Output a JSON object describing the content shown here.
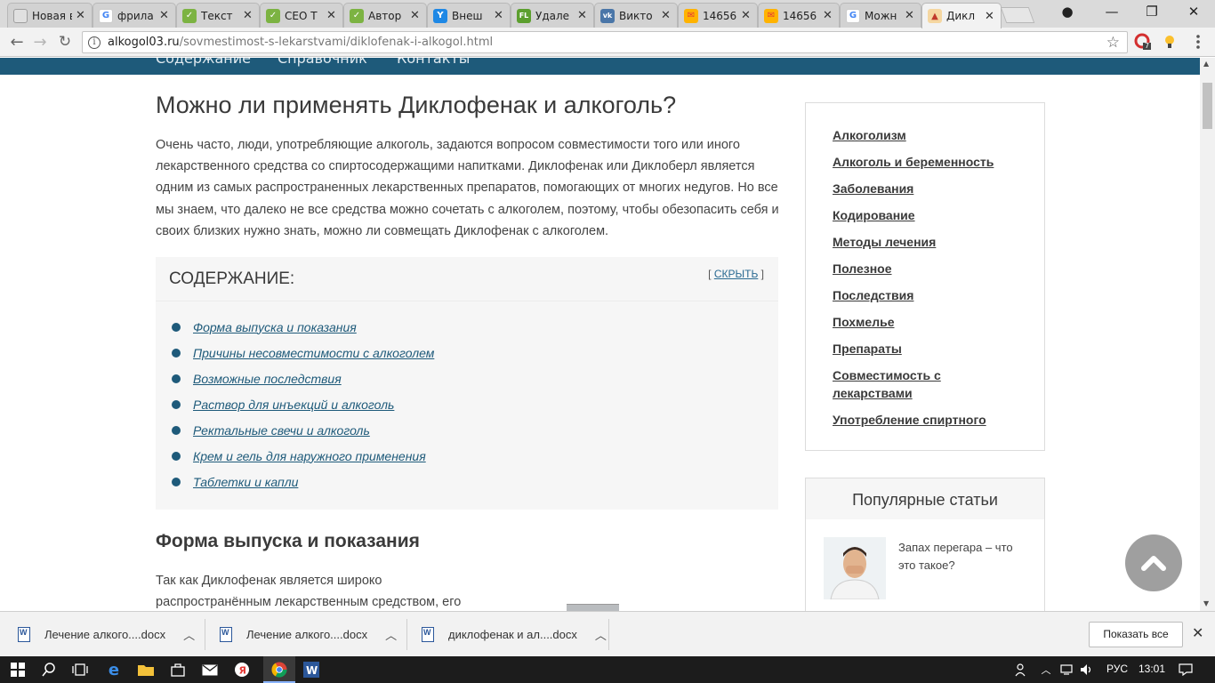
{
  "browser": {
    "tabs": [
      {
        "title": "Новая вкл",
        "favicon": "blank-page-icon",
        "color": "#9e9e9e"
      },
      {
        "title": "фрила",
        "favicon": "google-icon",
        "color": "#4285f4"
      },
      {
        "title": "Текст",
        "favicon": "leaf-icon",
        "color": "#7cb342"
      },
      {
        "title": "СЕО Т",
        "favicon": "leaf-icon",
        "color": "#7cb342"
      },
      {
        "title": "Автор",
        "favicon": "leaf-icon",
        "color": "#7cb342"
      },
      {
        "title": "Внеш",
        "favicon": "bird-icon",
        "color": "#1e88e5"
      },
      {
        "title": "Удале",
        "favicon": "fl-icon",
        "color": "#5c9f2e"
      },
      {
        "title": "Викто",
        "favicon": "vk-icon",
        "color": "#4a76a8"
      },
      {
        "title": "14656",
        "favicon": "mail-icon",
        "color": "#e53935"
      },
      {
        "title": "14656",
        "favicon": "mail-icon",
        "color": "#e53935"
      },
      {
        "title": "Можн",
        "favicon": "google-icon",
        "color": "#4285f4"
      },
      {
        "title": "Дикл",
        "favicon": "site-icon",
        "color": "#c0392b"
      }
    ],
    "address": {
      "host": "alkogol03.ru",
      "path": "/sovmestimost-s-lekarstvami/diklofenak-i-alkogol.html"
    },
    "extension_badge": "7"
  },
  "site": {
    "nav": [
      "Содержание",
      "Справочник",
      "Контакты"
    ]
  },
  "article": {
    "title": "Можно ли применять Диклофенак и алкоголь?",
    "intro": "Очень часто, люди, употребляющие алкоголь, задаются вопросом совместимости того или иного лекарственного средства со спиртосодержащими напитками. Диклофенак или Диклоберл является одним из самых распространенных лекарственных препаратов, помогающих от многих недугов. Но все мы знаем, что далеко не все средства можно сочетать с алкоголем, поэтому, чтобы обезопасить себя и своих близких нужно знать, можно ли совмещать Диклофенак с алкоголем.",
    "toc": {
      "title": "СОДЕРЖАНИЕ:",
      "hide_label": "СКРЫТЬ",
      "items": [
        "Форма выпуска и показания",
        "Причины несовместимости с алкоголем",
        "Возможные последствия",
        "Раствор для инъекций и алкоголь",
        "Ректальные свечи и алкоголь",
        "Крем и гель для наружного применения",
        "Таблетки и капли"
      ]
    },
    "section": {
      "title": "Форма выпуска и показания",
      "line1": "Так как Диклофенак является широко",
      "line2": "распространённым лекарственным средством, его"
    }
  },
  "sidebar": {
    "categories": [
      "Алкоголизм",
      "Алкоголь и беременность",
      "Заболевания",
      "Кодирование",
      "Методы лечения",
      "Полезное",
      "Последствия",
      "Похмелье",
      "Препараты",
      "Совместимость с лекарствами",
      "Употребление спиртного"
    ],
    "popular": {
      "title": "Популярные статьи",
      "item": "Запах перегара – что это такое?"
    }
  },
  "downloads": {
    "items": [
      "Лечение алкого....docx",
      "Лечение алкого....docx",
      "диклофенак и ал....docx"
    ],
    "show_all": "Показать все"
  },
  "taskbar": {
    "language": "РУС",
    "time": "13:01"
  },
  "colors": {
    "nav": "#1e5a7a",
    "link": "#1e5a7a",
    "toc_bg": "#f6f6f6"
  }
}
